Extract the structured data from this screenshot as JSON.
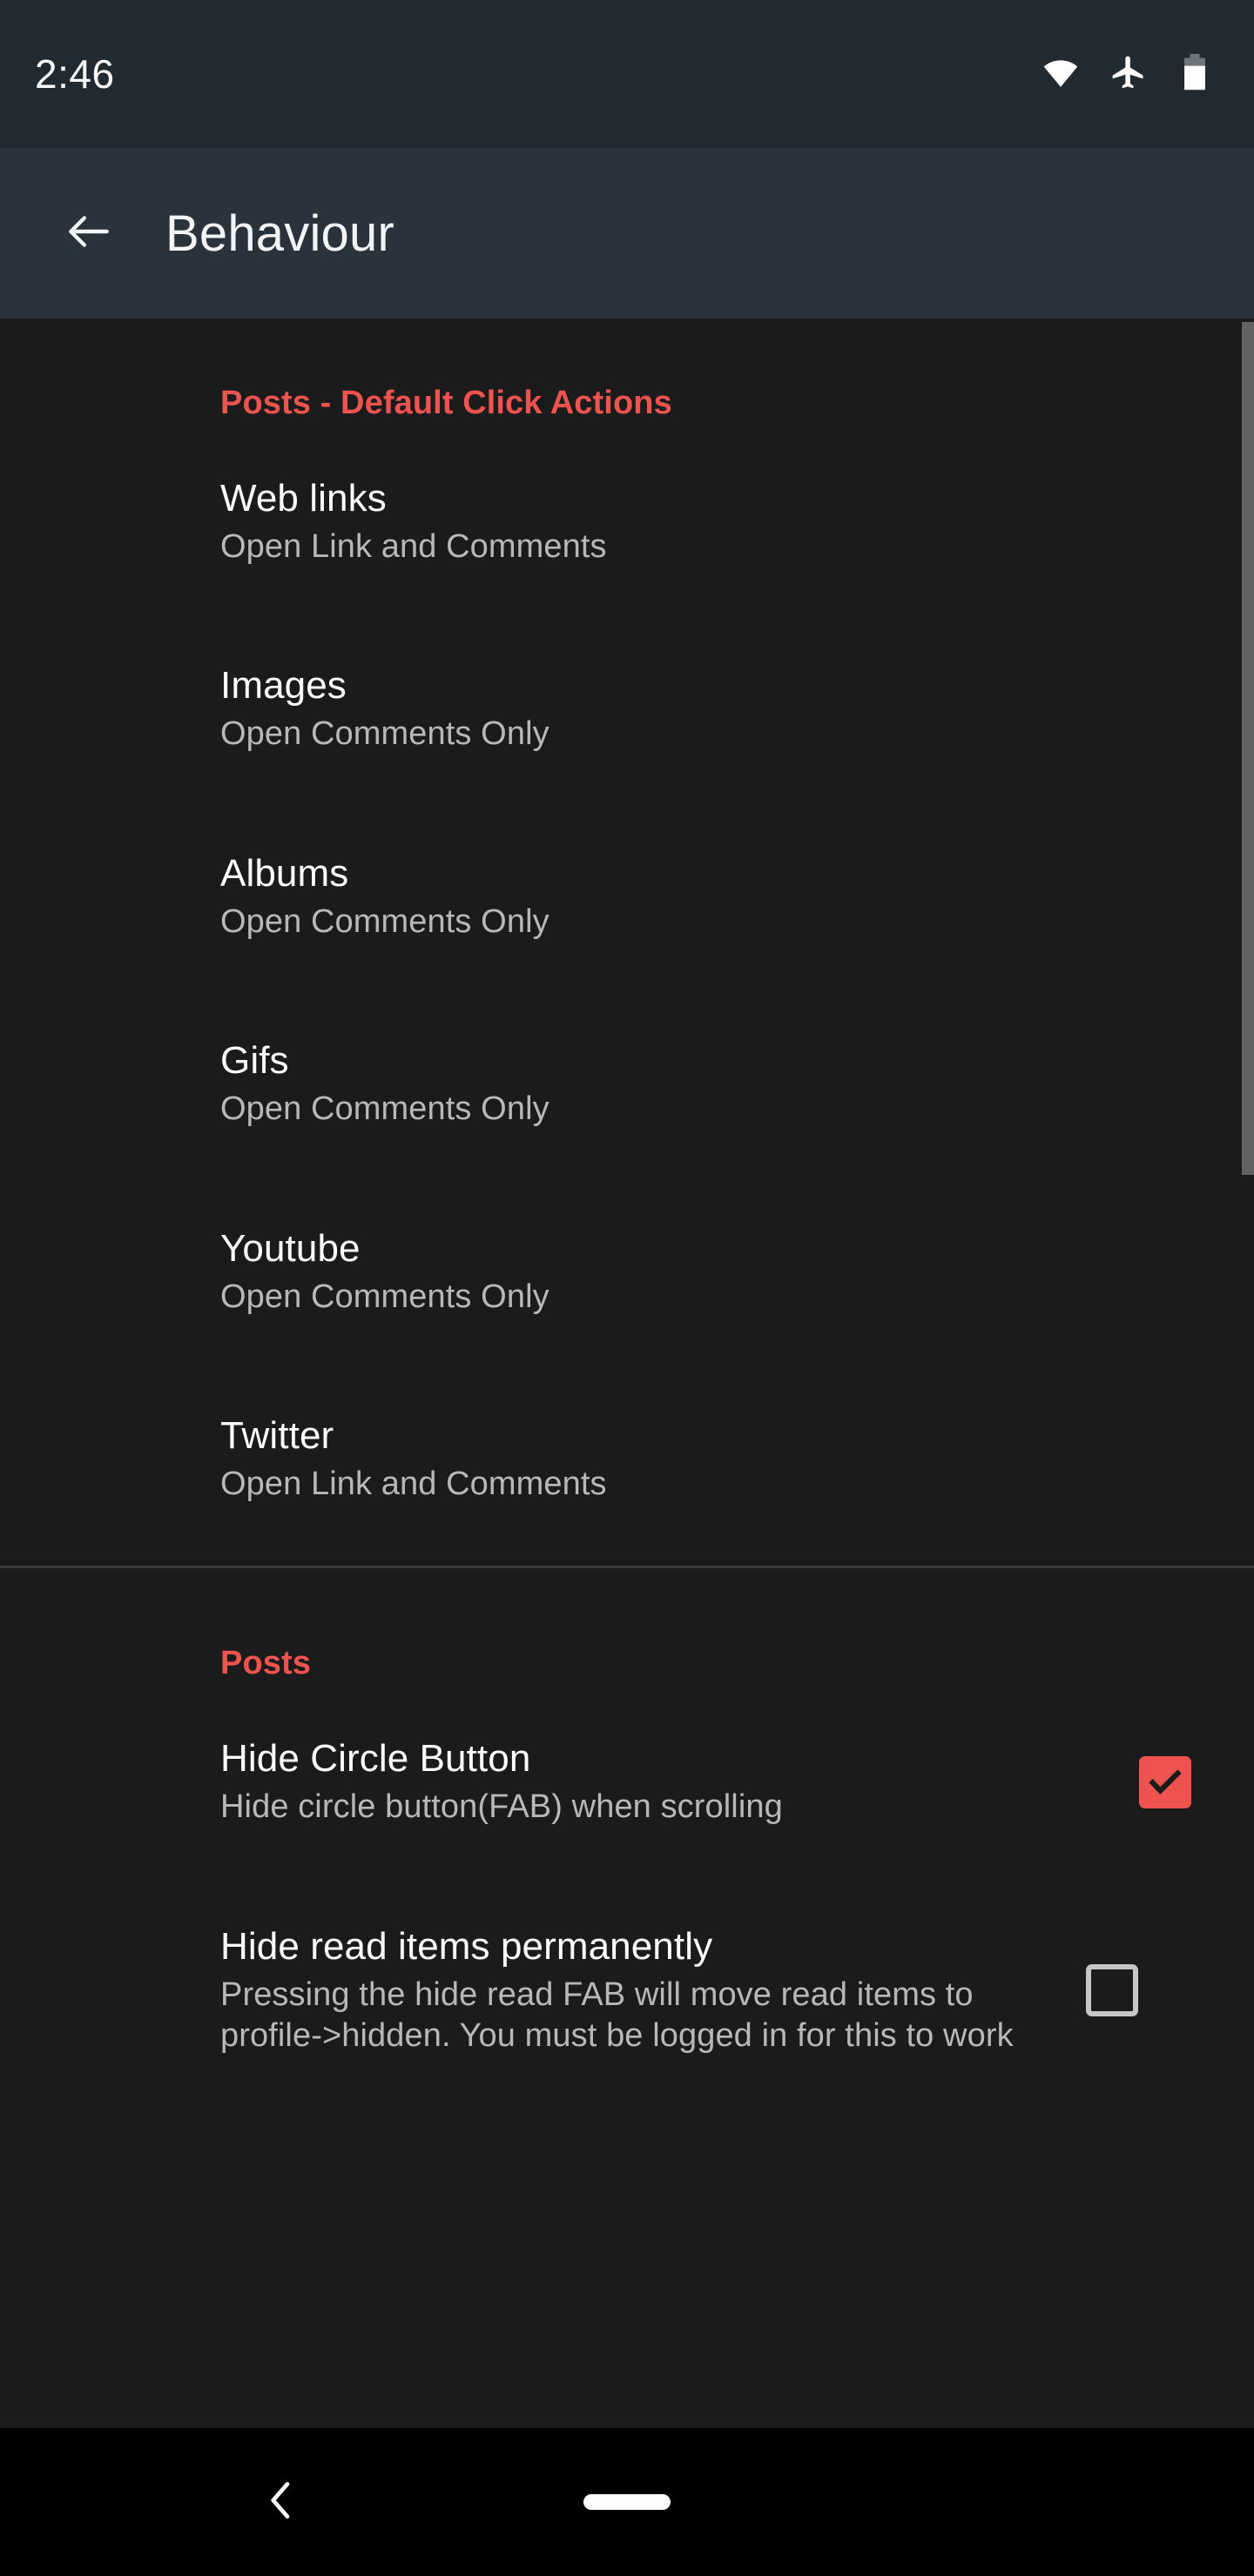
{
  "status_bar": {
    "time": "2:46",
    "icons": [
      {
        "name": "wifi-icon"
      },
      {
        "name": "airplane-mode-icon"
      },
      {
        "name": "battery-icon"
      }
    ]
  },
  "toolbar": {
    "back_icon": "arrow-back-icon",
    "title": "Behaviour"
  },
  "sections": [
    {
      "header": "Posts - Default Click Actions",
      "items": [
        {
          "title": "Web links",
          "summary": "Open Link and Comments"
        },
        {
          "title": "Images",
          "summary": "Open Comments Only"
        },
        {
          "title": "Albums",
          "summary": "Open Comments Only"
        },
        {
          "title": "Gifs",
          "summary": "Open Comments Only"
        },
        {
          "title": "Youtube",
          "summary": "Open Comments Only"
        },
        {
          "title": "Twitter",
          "summary": "Open Link and Comments"
        }
      ]
    },
    {
      "header": "Posts",
      "items": [
        {
          "title": "Hide Circle Button",
          "summary": "Hide circle button(FAB) when scrolling",
          "checked": true
        },
        {
          "title": "Hide read items permanently",
          "summary": "Pressing the hide read FAB will move read items to profile->hidden. You must be logged in for this to work",
          "checked": false
        }
      ]
    }
  ],
  "nav_bar": {
    "back_icon": "chevron-back-icon",
    "home_icon": "home-pill-icon"
  },
  "colors": {
    "accent": "#ef5350",
    "background": "#1b1b1b",
    "toolbar": "#2a333b",
    "status_bar": "#222a31",
    "title_text": "#ffffff",
    "summary_text": "#b8b8b8",
    "nav_bar": "#000000"
  }
}
